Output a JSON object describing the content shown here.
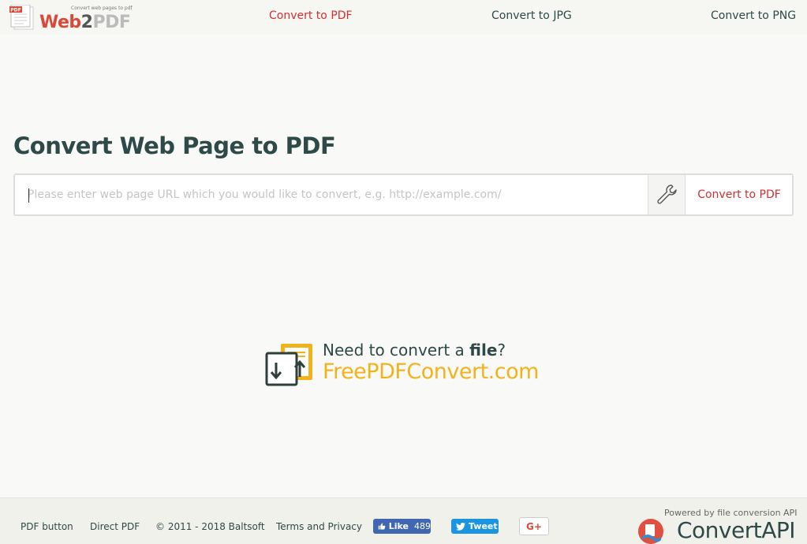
{
  "header": {
    "logo": {
      "tagline": "Convert web pages to pdf",
      "brand_web": "Web",
      "brand_two": "2",
      "brand_pdf": "PDF",
      "badge": "PDF"
    },
    "nav": [
      {
        "label": "Convert to PDF",
        "active": true
      },
      {
        "label": "Convert to JPG",
        "active": false
      },
      {
        "label": "Convert to PNG",
        "active": false
      }
    ]
  },
  "main": {
    "title": "Convert Web Page to PDF",
    "url_input": {
      "placeholder": "Please enter web page URL which you would like to convert, e.g. http://example.com/",
      "value": ""
    },
    "settings_icon": "wrench-icon",
    "convert_button": "Convert to PDF"
  },
  "promo": {
    "line1_prefix": "Need to convert a ",
    "line1_bold": "file",
    "line1_suffix": "?",
    "line2": "FreePDFConvert.com",
    "icon": "file-convert-icon"
  },
  "footer": {
    "links": [
      "PDF button",
      "Direct PDF",
      "Terms and Privacy"
    ],
    "copyright": "© 2011 - 2018 Baltsoft",
    "facebook": {
      "label": "Like",
      "count": "489"
    },
    "twitter": {
      "label": "Tweet"
    },
    "googleplus": {
      "label": "G+"
    },
    "powered_by": "Powered by file conversion API",
    "convertapi": "ConvertAPI"
  },
  "colors": {
    "accent_red": "#d03030",
    "dark_teal": "#2e4a48",
    "promo_yellow": "#f2b21b",
    "facebook": "#4267b2",
    "twitter": "#1b95e0"
  }
}
